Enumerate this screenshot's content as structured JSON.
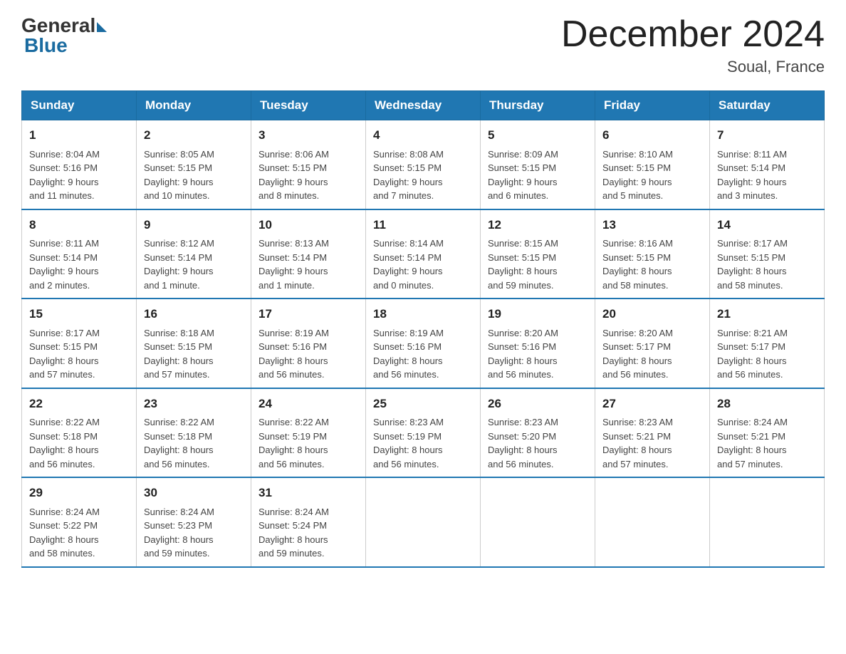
{
  "header": {
    "logo_general": "General",
    "logo_blue": "Blue",
    "month_title": "December 2024",
    "location": "Soual, France"
  },
  "days_of_week": [
    "Sunday",
    "Monday",
    "Tuesday",
    "Wednesday",
    "Thursday",
    "Friday",
    "Saturday"
  ],
  "weeks": [
    [
      {
        "day": "1",
        "sunrise": "8:04 AM",
        "sunset": "5:16 PM",
        "daylight": "9 hours and 11 minutes."
      },
      {
        "day": "2",
        "sunrise": "8:05 AM",
        "sunset": "5:15 PM",
        "daylight": "9 hours and 10 minutes."
      },
      {
        "day": "3",
        "sunrise": "8:06 AM",
        "sunset": "5:15 PM",
        "daylight": "9 hours and 8 minutes."
      },
      {
        "day": "4",
        "sunrise": "8:08 AM",
        "sunset": "5:15 PM",
        "daylight": "9 hours and 7 minutes."
      },
      {
        "day": "5",
        "sunrise": "8:09 AM",
        "sunset": "5:15 PM",
        "daylight": "9 hours and 6 minutes."
      },
      {
        "day": "6",
        "sunrise": "8:10 AM",
        "sunset": "5:15 PM",
        "daylight": "9 hours and 5 minutes."
      },
      {
        "day": "7",
        "sunrise": "8:11 AM",
        "sunset": "5:14 PM",
        "daylight": "9 hours and 3 minutes."
      }
    ],
    [
      {
        "day": "8",
        "sunrise": "8:11 AM",
        "sunset": "5:14 PM",
        "daylight": "9 hours and 2 minutes."
      },
      {
        "day": "9",
        "sunrise": "8:12 AM",
        "sunset": "5:14 PM",
        "daylight": "9 hours and 1 minute."
      },
      {
        "day": "10",
        "sunrise": "8:13 AM",
        "sunset": "5:14 PM",
        "daylight": "9 hours and 1 minute."
      },
      {
        "day": "11",
        "sunrise": "8:14 AM",
        "sunset": "5:14 PM",
        "daylight": "9 hours and 0 minutes."
      },
      {
        "day": "12",
        "sunrise": "8:15 AM",
        "sunset": "5:15 PM",
        "daylight": "8 hours and 59 minutes."
      },
      {
        "day": "13",
        "sunrise": "8:16 AM",
        "sunset": "5:15 PM",
        "daylight": "8 hours and 58 minutes."
      },
      {
        "day": "14",
        "sunrise": "8:17 AM",
        "sunset": "5:15 PM",
        "daylight": "8 hours and 58 minutes."
      }
    ],
    [
      {
        "day": "15",
        "sunrise": "8:17 AM",
        "sunset": "5:15 PM",
        "daylight": "8 hours and 57 minutes."
      },
      {
        "day": "16",
        "sunrise": "8:18 AM",
        "sunset": "5:15 PM",
        "daylight": "8 hours and 57 minutes."
      },
      {
        "day": "17",
        "sunrise": "8:19 AM",
        "sunset": "5:16 PM",
        "daylight": "8 hours and 56 minutes."
      },
      {
        "day": "18",
        "sunrise": "8:19 AM",
        "sunset": "5:16 PM",
        "daylight": "8 hours and 56 minutes."
      },
      {
        "day": "19",
        "sunrise": "8:20 AM",
        "sunset": "5:16 PM",
        "daylight": "8 hours and 56 minutes."
      },
      {
        "day": "20",
        "sunrise": "8:20 AM",
        "sunset": "5:17 PM",
        "daylight": "8 hours and 56 minutes."
      },
      {
        "day": "21",
        "sunrise": "8:21 AM",
        "sunset": "5:17 PM",
        "daylight": "8 hours and 56 minutes."
      }
    ],
    [
      {
        "day": "22",
        "sunrise": "8:22 AM",
        "sunset": "5:18 PM",
        "daylight": "8 hours and 56 minutes."
      },
      {
        "day": "23",
        "sunrise": "8:22 AM",
        "sunset": "5:18 PM",
        "daylight": "8 hours and 56 minutes."
      },
      {
        "day": "24",
        "sunrise": "8:22 AM",
        "sunset": "5:19 PM",
        "daylight": "8 hours and 56 minutes."
      },
      {
        "day": "25",
        "sunrise": "8:23 AM",
        "sunset": "5:19 PM",
        "daylight": "8 hours and 56 minutes."
      },
      {
        "day": "26",
        "sunrise": "8:23 AM",
        "sunset": "5:20 PM",
        "daylight": "8 hours and 56 minutes."
      },
      {
        "day": "27",
        "sunrise": "8:23 AM",
        "sunset": "5:21 PM",
        "daylight": "8 hours and 57 minutes."
      },
      {
        "day": "28",
        "sunrise": "8:24 AM",
        "sunset": "5:21 PM",
        "daylight": "8 hours and 57 minutes."
      }
    ],
    [
      {
        "day": "29",
        "sunrise": "8:24 AM",
        "sunset": "5:22 PM",
        "daylight": "8 hours and 58 minutes."
      },
      {
        "day": "30",
        "sunrise": "8:24 AM",
        "sunset": "5:23 PM",
        "daylight": "8 hours and 59 minutes."
      },
      {
        "day": "31",
        "sunrise": "8:24 AM",
        "sunset": "5:24 PM",
        "daylight": "8 hours and 59 minutes."
      },
      null,
      null,
      null,
      null
    ]
  ],
  "labels": {
    "sunrise": "Sunrise:",
    "sunset": "Sunset:",
    "daylight": "Daylight:"
  }
}
